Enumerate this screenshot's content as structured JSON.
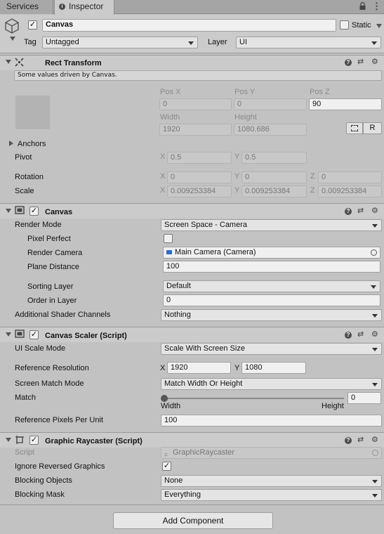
{
  "tabs": {
    "services": "Services",
    "inspector": "Inspector"
  },
  "object": {
    "name": "Canvas",
    "static_label": "Static",
    "tag_label": "Tag",
    "tag_value": "Untagged",
    "layer_label": "Layer",
    "layer_value": "UI"
  },
  "rect_transform": {
    "title": "Rect Transform",
    "note": "Some values driven by Canvas.",
    "pos_x_label": "Pos X",
    "pos_y_label": "Pos Y",
    "pos_z_label": "Pos Z",
    "pos_x": "0",
    "pos_y": "0",
    "pos_z": "90",
    "width_label": "Width",
    "height_label": "Height",
    "width": "1920",
    "height": "1080.686",
    "r_button": "R",
    "anchors_label": "Anchors",
    "pivot_label": "Pivot",
    "pivot_x": "0.5",
    "pivot_y": "0.5",
    "rotation_label": "Rotation",
    "rot_x": "0",
    "rot_y": "0",
    "rot_z": "0",
    "scale_label": "Scale",
    "scale_x": "0.009253384",
    "scale_y": "0.009253384",
    "scale_z": "0.009253384",
    "x": "X",
    "y": "Y",
    "z": "Z"
  },
  "canvas": {
    "title": "Canvas",
    "render_mode_label": "Render Mode",
    "render_mode": "Screen Space - Camera",
    "pixel_perfect_label": "Pixel Perfect",
    "render_camera_label": "Render Camera",
    "render_camera": "Main Camera (Camera)",
    "plane_distance_label": "Plane Distance",
    "plane_distance": "100",
    "sorting_layer_label": "Sorting Layer",
    "sorting_layer": "Default",
    "order_in_layer_label": "Order in Layer",
    "order_in_layer": "0",
    "shader_channels_label": "Additional Shader Channels",
    "shader_channels": "Nothing"
  },
  "canvas_scaler": {
    "title": "Canvas Scaler (Script)",
    "ui_scale_mode_label": "UI Scale Mode",
    "ui_scale_mode": "Scale With Screen Size",
    "ref_resolution_label": "Reference Resolution",
    "ref_x": "1920",
    "ref_y": "1080",
    "x": "X",
    "y": "Y",
    "screen_match_label": "Screen Match Mode",
    "screen_match": "Match Width Or Height",
    "match_label": "Match",
    "match_value": "0",
    "match_fraction": 0,
    "width_caption": "Width",
    "height_caption": "Height",
    "ref_ppu_label": "Reference Pixels Per Unit",
    "ref_ppu": "100"
  },
  "raycaster": {
    "title": "Graphic Raycaster (Script)",
    "script_label": "Script",
    "script_value": "GraphicRaycaster",
    "ignore_reversed_label": "Ignore Reversed Graphics",
    "blocking_objects_label": "Blocking Objects",
    "blocking_objects": "None",
    "blocking_mask_label": "Blocking Mask",
    "blocking_mask": "Everything"
  },
  "add_component": "Add Component",
  "checkmark": "✓"
}
